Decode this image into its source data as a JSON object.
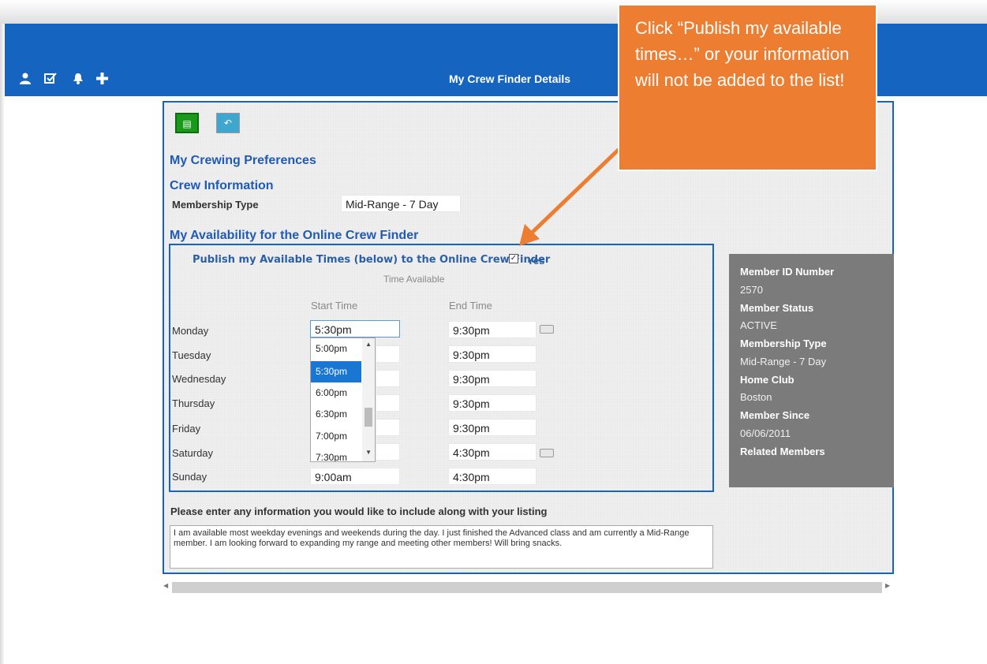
{
  "header": {
    "title": "My Crew Finder Details",
    "icons": [
      "user-icon",
      "checklist-icon",
      "bell-icon",
      "plus-icon"
    ],
    "bg_color": "#1565c0"
  },
  "toolbar": {
    "list_button_icon": "list-icon",
    "back_button_icon": "back-icon"
  },
  "sections": {
    "crewing_preferences": "My Crewing Preferences",
    "crew_information": "Crew Information",
    "membership_type_label": "Membership Type",
    "membership_type_value": "Mid-Range - 7 Day",
    "availability_heading": "My Availability for the Online Crew Finder"
  },
  "availability": {
    "publish_label": "Publish my Available Times (below) to the Online Crew Finder",
    "publish_checked": true,
    "yes_label": "Yes",
    "time_available_label": "Time Available",
    "start_col": "Start Time",
    "end_col": "End Time",
    "rows": [
      {
        "day": "Monday",
        "start": "5:30pm",
        "end": "9:30pm"
      },
      {
        "day": "Tuesday",
        "start": "",
        "end": "9:30pm"
      },
      {
        "day": "Wednesday",
        "start": "",
        "end": "9:30pm"
      },
      {
        "day": "Thursday",
        "start": "",
        "end": "9:30pm"
      },
      {
        "day": "Friday",
        "start": "",
        "end": "9:30pm"
      },
      {
        "day": "Saturday",
        "start": "",
        "end": "4:30pm"
      },
      {
        "day": "Sunday",
        "start": "9:00am",
        "end": "4:30pm"
      }
    ],
    "dropdown_options": [
      "5:00pm",
      "5:30pm",
      "6:00pm",
      "6:30pm",
      "7:00pm",
      "7:30pm"
    ],
    "dropdown_selected": "5:30pm"
  },
  "member_info": {
    "id_label": "Member ID Number",
    "id_value": "2570",
    "status_label": "Member Status",
    "status_value": "ACTIVE",
    "type_label": "Membership Type",
    "type_value": "Mid-Range - 7 Day",
    "club_label": "Home Club",
    "club_value": "Boston",
    "since_label": "Member Since",
    "since_value": "06/06/2011",
    "related_label": "Related Members"
  },
  "listing": {
    "question": "Please enter any information you would like to include along with your listing",
    "text": "I am available most weekday evenings and weekends during the day. I just finished the Advanced class and am currently a Mid-Range member. I am looking forward to expanding my range and meeting other members! Will bring snacks."
  },
  "callout": {
    "text": "Click “Publish my available times…” or your information will not be added to the list!",
    "color": "#ed7d31"
  }
}
